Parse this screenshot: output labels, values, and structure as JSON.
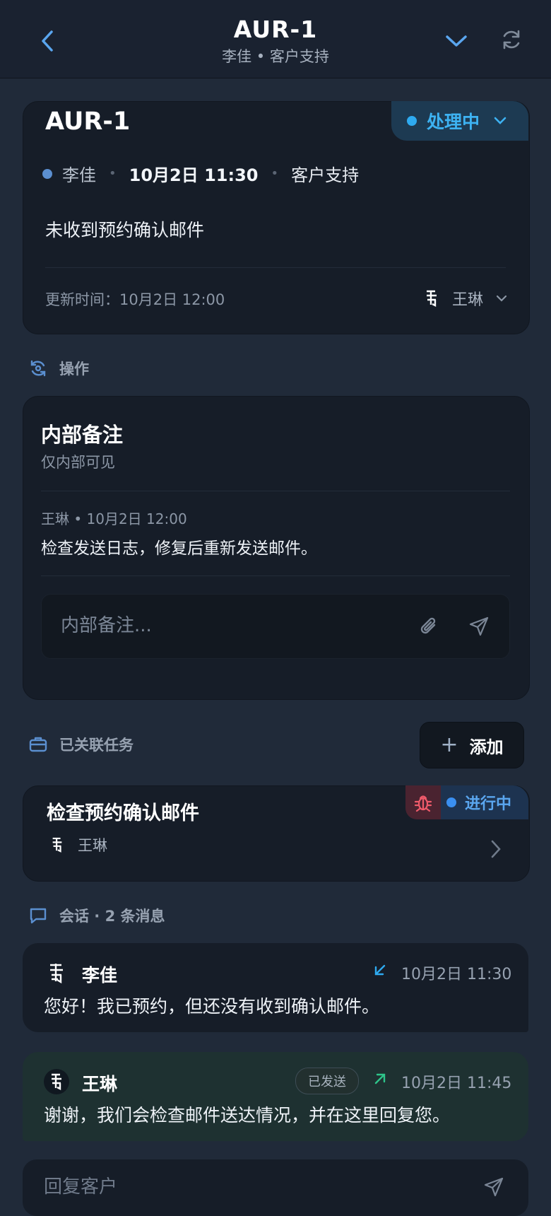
{
  "header": {
    "title": "AUR-1",
    "subtitle": "李佳 • 客户支持"
  },
  "ticket": {
    "id": "AUR-1",
    "status": "处理中",
    "requester": "李佳",
    "created": "10月2日 11:30",
    "category": "客户支持",
    "subject": "未收到预约确认邮件",
    "updated": "更新时间：10月2日 12:00",
    "assignee": "王琳",
    "colors": {
      "status": "#3db2f2",
      "requester_dot": "#5b8fd0"
    }
  },
  "actions": {
    "label": "操作",
    "note": {
      "title": "内部备注",
      "subtitle": "仅内部可见",
      "entry_meta": "王琳 • 10月2日 12:00",
      "entry_body": "检查发送日志，修复后重新发送邮件。",
      "input_placeholder": "内部备注..."
    }
  },
  "linked": {
    "label": "已关联任务",
    "add_label": "添加",
    "task": {
      "title": "检查预约确认邮件",
      "assignee": "王琳",
      "status": "进行中",
      "type_icon": "bug-icon"
    }
  },
  "conversation": {
    "label": "会话 · 2 条消息",
    "messages": [
      {
        "name": "李佳",
        "direction": "inbound",
        "time": "10月2日 11:30",
        "text": "您好！我已预约，但还没有收到确认邮件。"
      },
      {
        "name": "王琳",
        "direction": "outbound",
        "badge": "已发送",
        "time": "10月2日 11:45",
        "text": "谢谢，我们会检查邮件送达情况，并在这里回复您。"
      }
    ]
  },
  "reply": {
    "placeholder": "回复客户"
  }
}
